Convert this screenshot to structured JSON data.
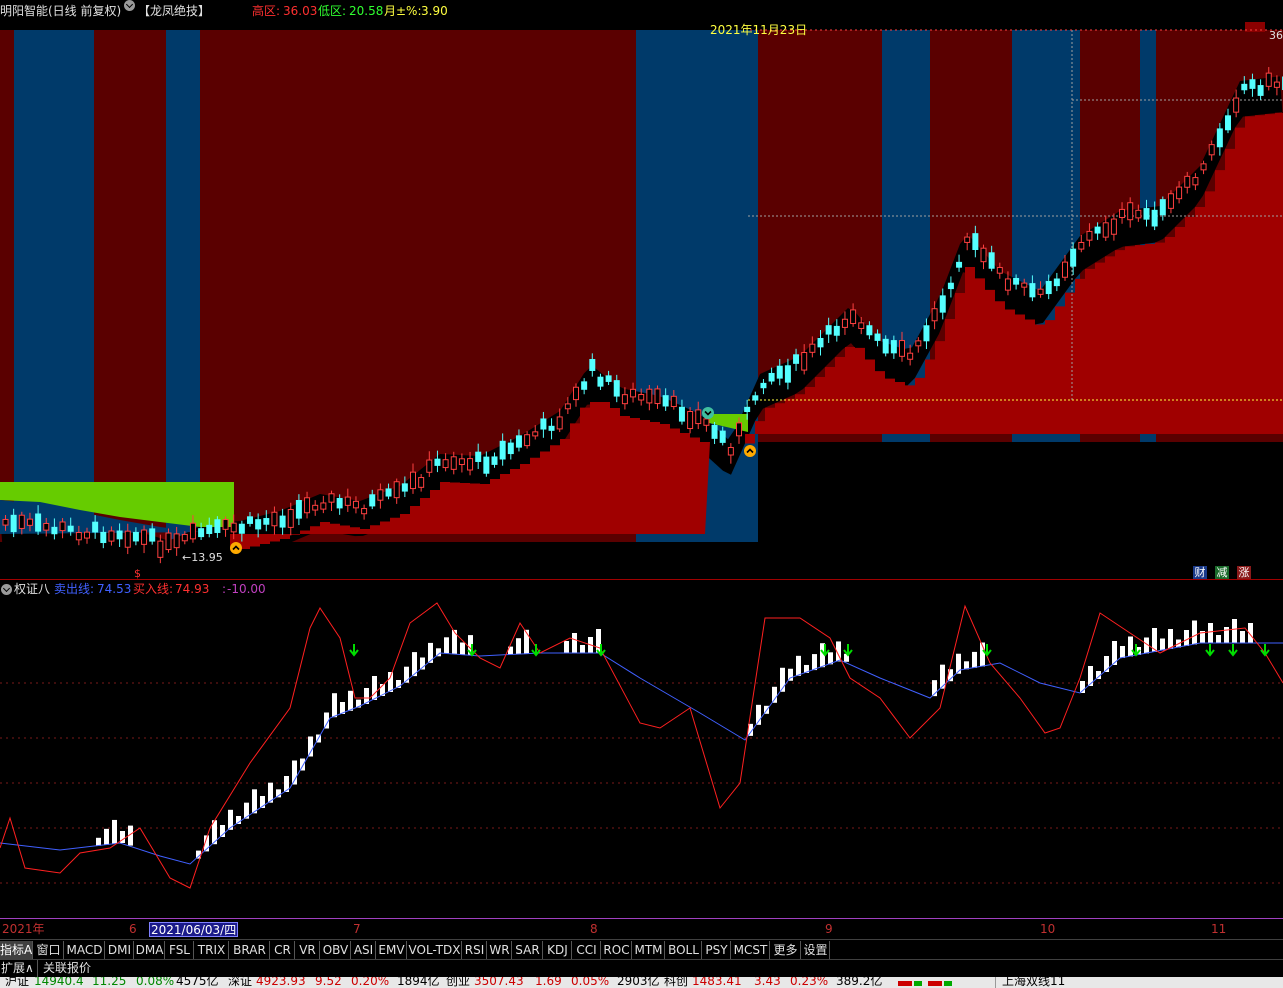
{
  "header": {
    "stock_title": "明阳智能(日线 前复权)",
    "indicator_name": "【龙凤绝技】",
    "high_label": "高区:",
    "high_value": "36.03",
    "low_label": "低区:",
    "low_value": "20.58",
    "month_label": "月±%:",
    "month_value": "3.90"
  },
  "main_chart": {
    "date_annotation": "2021年11月23日",
    "high_marker": "36",
    "low_marker": "←13.95",
    "dollar_marker": "$",
    "badges": [
      "财",
      "减",
      "涨"
    ],
    "colors": {
      "bull_zone": "#5a0000",
      "bear_zone": "#003a6a",
      "support": "#a00000",
      "green_zone": "#66cc00",
      "up_candle": "#ff4040",
      "down_candle": "#55ffff"
    }
  },
  "sub_chart": {
    "name": "权证八",
    "sell_label": "卖出线:",
    "sell_value": "74.53",
    "buy_label": "买入线:",
    "buy_value": "74.93",
    "third_label": ":",
    "third_value": "-10.00",
    "colors": {
      "sell_line": "#4060ff",
      "buy_line": "#ff2020",
      "marker": "#00dd00"
    }
  },
  "date_axis": {
    "labels": [
      "2021年",
      "6",
      "7",
      "8",
      "9",
      "10",
      "11"
    ],
    "cursor_date": "2021/06/03/四"
  },
  "indicator_tabs": [
    "指标A",
    "窗口",
    "MACD",
    "DMI",
    "DMA",
    "FSL",
    "TRIX",
    "BRAR",
    "CR",
    "VR",
    "OBV",
    "ASI",
    "EMV",
    "VOL-TDX",
    "RSI",
    "WR",
    "SAR",
    "KDJ",
    "CCI",
    "ROC",
    "MTM",
    "BOLL",
    "PSY",
    "MCST",
    "更多",
    "设置"
  ],
  "bottom_row": {
    "expand": "扩展∧",
    "related": "关联报价"
  },
  "status_bar": {
    "items": [
      {
        "name": "沪证",
        "value": "14940.4",
        "change": "11.25",
        "pct": "0.08%",
        "vol": "4575亿"
      },
      {
        "name": "深证",
        "value": "4923.93",
        "change": "9.52",
        "pct": "0.20%",
        "vol": "1894亿"
      },
      {
        "name": "创业",
        "value": "3507.43",
        "change": "1.69",
        "pct": "0.05%",
        "vol": "2903亿"
      },
      {
        "name": "科创",
        "value": "1483.41",
        "change": "3.43",
        "pct": "0.23%",
        "vol": "389.2亿"
      }
    ],
    "right_text": "上海双线11"
  }
}
